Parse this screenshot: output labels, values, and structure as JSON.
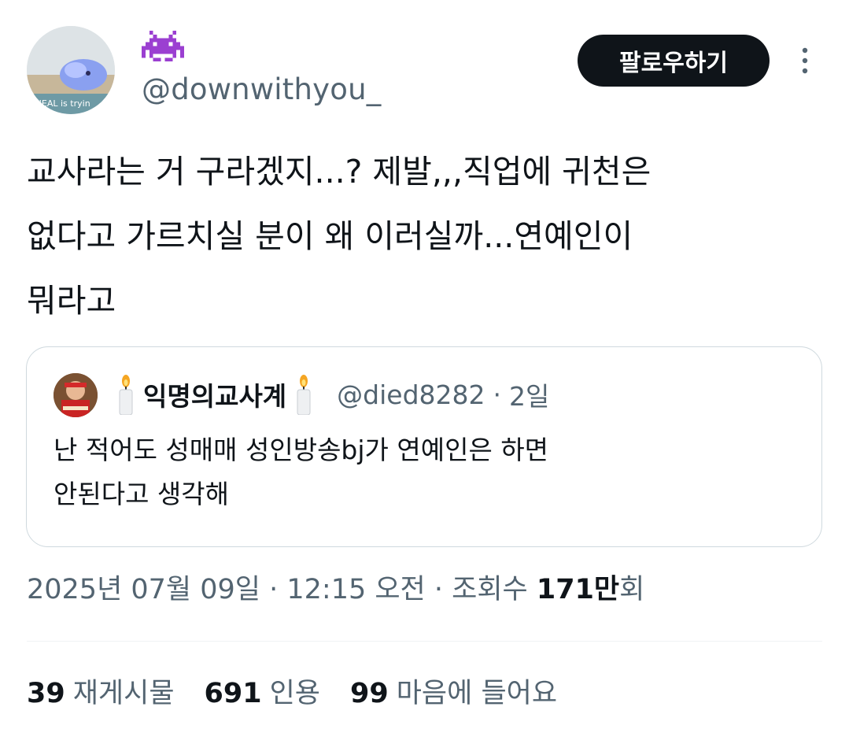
{
  "author": {
    "display_name_icon": "purple-space-invader-emoji",
    "handle": "@downwithyou_",
    "avatar_caption": "PHEAL is tryin"
  },
  "follow_button": {
    "label": "팔로우하기"
  },
  "more_icon": "more-vertical-icon",
  "tweet": {
    "lines": [
      "교사라는 거 구라겠지...? 제발,,,직업에 귀천은",
      "없다고 가르치실 분이 왜 이러실까...연예인이",
      "뭐라고"
    ]
  },
  "quote": {
    "name": "익명의교사계",
    "name_emoji": "candle-emoji",
    "handle": "@died8282",
    "separator": "·",
    "time": "2일",
    "lines": [
      "난 적어도 성매매 성인방송bj가 연예인은 하면",
      "안된다고 생각해"
    ]
  },
  "meta": {
    "datetime": "2025년 07월 09일 · 12:15 오전 · 조회수 ",
    "views_value": "171만",
    "views_suffix": "회"
  },
  "stats": [
    {
      "num": "39",
      "label": "재게시물"
    },
    {
      "num": "691",
      "label": "인용"
    },
    {
      "num": "99",
      "label": "마음에 들어요"
    }
  ],
  "colors": {
    "text_primary": "#0f1419",
    "text_secondary": "#536471",
    "border": "#cfd9de",
    "invader": "#9b3fd1"
  }
}
